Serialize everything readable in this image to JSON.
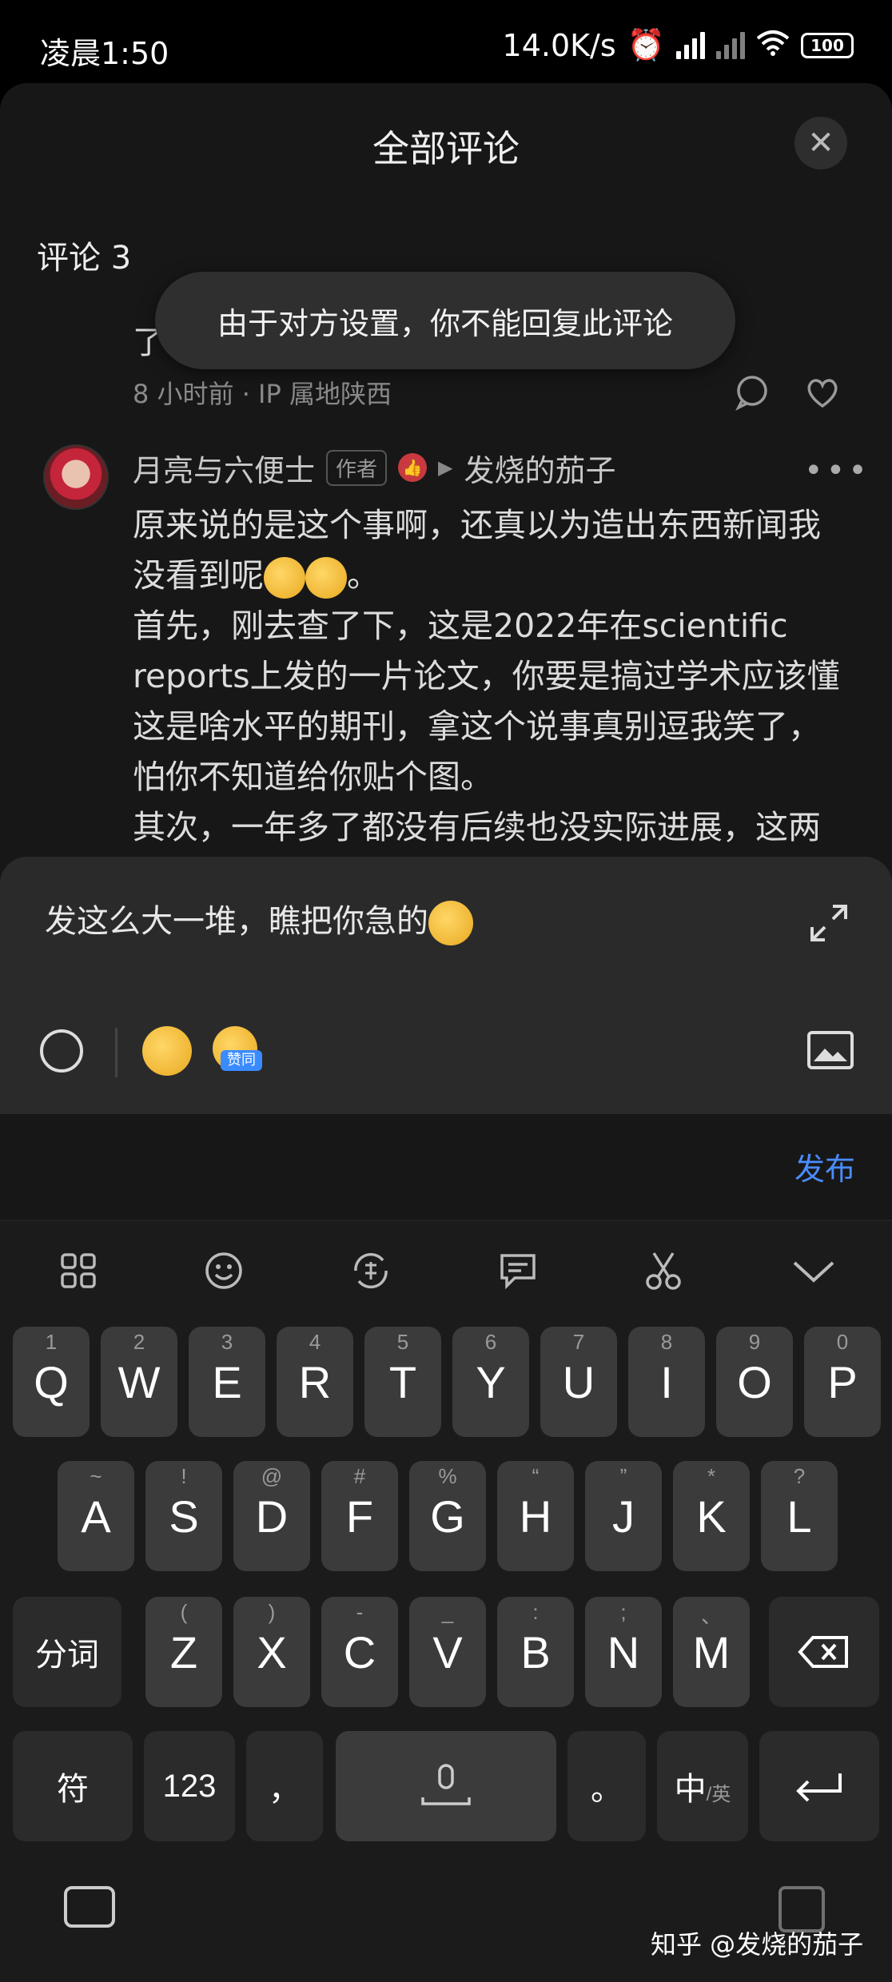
{
  "status_bar": {
    "time": "凌晨1:50",
    "speed": "14.0K/s",
    "battery": "100"
  },
  "sheet": {
    "title": "全部评论",
    "count_label": "评论 3"
  },
  "toast": "由于对方设置，你不能回复此评论",
  "prev_comment": {
    "cut_text": "了",
    "meta": "8 小时前 · IP 属地陕西"
  },
  "comment": {
    "author": "月亮与六便士",
    "author_badge": "作者",
    "reply_to": "发烧的茄子",
    "lines": [
      "原来说的是这个事啊，还真以为造出东西新闻我",
      "没看到呢",
      "首先，刚去查了下，这是2022年在scientific",
      "reports上发的一片论文，你要是搞过学术应该懂",
      "这是啥水平的期刊，拿这个说事真别逗我笑了，",
      "怕你不知道给你贴个图。",
      "其次，一年多了都没有后续也没实际进展，这两"
    ],
    "line2_suffix": "。"
  },
  "compose": {
    "text": "发这么大一堆，瞧把你急的",
    "quick_badge": "赞同",
    "publish_label": "发布"
  },
  "keyboard": {
    "row1": [
      {
        "k": "Q",
        "s": "1"
      },
      {
        "k": "W",
        "s": "2"
      },
      {
        "k": "E",
        "s": "3"
      },
      {
        "k": "R",
        "s": "4"
      },
      {
        "k": "T",
        "s": "5"
      },
      {
        "k": "Y",
        "s": "6"
      },
      {
        "k": "U",
        "s": "7"
      },
      {
        "k": "I",
        "s": "8"
      },
      {
        "k": "O",
        "s": "9"
      },
      {
        "k": "P",
        "s": "0"
      }
    ],
    "row2": [
      {
        "k": "A",
        "s": "~"
      },
      {
        "k": "S",
        "s": "!"
      },
      {
        "k": "D",
        "s": "@"
      },
      {
        "k": "F",
        "s": "#"
      },
      {
        "k": "G",
        "s": "%"
      },
      {
        "k": "H",
        "s": "“"
      },
      {
        "k": "J",
        "s": "”"
      },
      {
        "k": "K",
        "s": "*"
      },
      {
        "k": "L",
        "s": "?"
      }
    ],
    "row3": [
      {
        "k": "Z",
        "s": "("
      },
      {
        "k": "X",
        "s": ")"
      },
      {
        "k": "C",
        "s": "-"
      },
      {
        "k": "V",
        "s": "_"
      },
      {
        "k": "B",
        "s": ":"
      },
      {
        "k": "N",
        "s": ";"
      },
      {
        "k": "M",
        "s": "、"
      }
    ],
    "fenci": "分词",
    "fu": "符",
    "num": "123",
    "comma": "，",
    "period": "。",
    "zh": "中",
    "en": "/英"
  },
  "watermark": "知乎 @发烧的茄子"
}
